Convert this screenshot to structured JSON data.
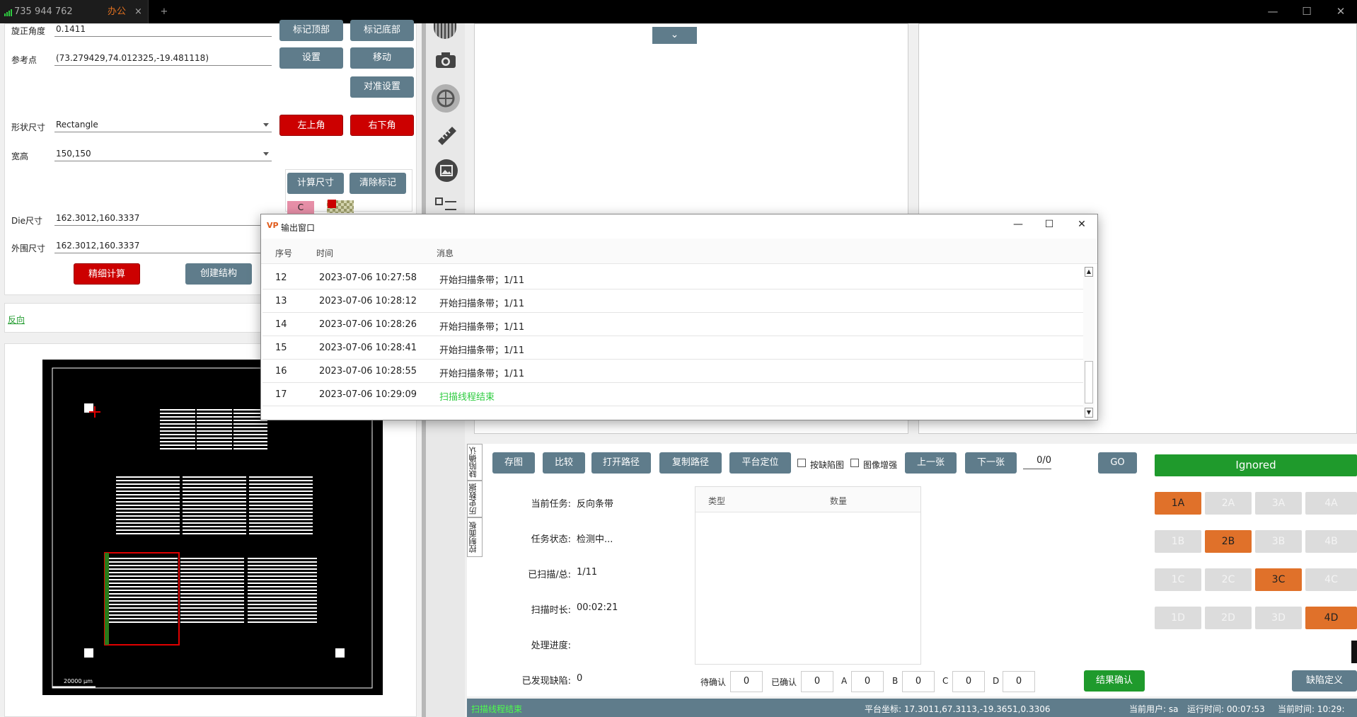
{
  "titlebar": {
    "tab_title": "735 944 762",
    "tab_group": "办公",
    "close_tab": "×",
    "new_tab": "+",
    "minimize": "—",
    "maximize": "☐",
    "close": "✕"
  },
  "settings": {
    "rotation_label": "旋正角度",
    "rotation_value": "0.1411",
    "ref_label": "参考点",
    "ref_value": "(73.279429,74.012325,-19.481118)",
    "shape_label": "形状尺寸",
    "shape_value": "Rectangle",
    "wh_label": "宽高",
    "wh_value": "150,150",
    "die_label": "Die尺寸",
    "die_value": "162.3012,160.3337",
    "outer_label": "外围尺寸",
    "outer_value": "162.3012,160.3337",
    "btn_mark_top": "标记顶部",
    "btn_mark_bottom": "标记底部",
    "btn_set": "设置",
    "btn_move": "移动",
    "btn_align": "对准设置",
    "btn_top_left": "左上角",
    "btn_bottom_right": "右下角",
    "btn_calc": "计算尺寸",
    "btn_clear": "清除标记",
    "swatch_c": "C",
    "btn_fine": "精细计算",
    "btn_create": "创建结构"
  },
  "reverse_label": "反向",
  "preview": {
    "scale_label": "20000 μm"
  },
  "dialog": {
    "title": "输出窗口",
    "col_seq": "序号",
    "col_time": "时间",
    "col_msg": "消息",
    "rows": [
      {
        "seq": "12",
        "time": "2023-07-06 10:27:58",
        "msg": "开始扫描条带；1/11"
      },
      {
        "seq": "13",
        "time": "2023-07-06 10:28:12",
        "msg": "开始扫描条带；1/11"
      },
      {
        "seq": "14",
        "time": "2023-07-06 10:28:26",
        "msg": "开始扫描条带；1/11"
      },
      {
        "seq": "15",
        "time": "2023-07-06 10:28:41",
        "msg": "开始扫描条带；1/11"
      },
      {
        "seq": "16",
        "time": "2023-07-06 10:28:55",
        "msg": "开始扫描条带；1/11"
      },
      {
        "seq": "17",
        "time": "2023-07-06 10:29:09",
        "msg": "扫描线程结束"
      }
    ]
  },
  "bottom": {
    "vtabs": [
      "缺陷确认",
      "历史数据",
      "控制面板"
    ],
    "btn_save": "存图",
    "btn_compare": "比较",
    "btn_open_path": "打开路径",
    "btn_copy_path": "复制路径",
    "btn_locate": "平台定位",
    "chk_defect": "按缺陷图",
    "chk_enhance": "图像增强",
    "btn_prev": "上一张",
    "btn_next": "下一张",
    "page": "0/0",
    "btn_go": "GO",
    "ignored": "Ignored",
    "task_label": "当前任务:",
    "task_value": "反向条带",
    "status_label": "任务状态:",
    "status_value": "检测中...",
    "scanned_label": "已扫描/总:",
    "scanned_value": "1/11",
    "duration_label": "扫描时长:",
    "duration_value": "00:02:21",
    "progress_label": "处理进度:",
    "found_label": "已发现缺陷:",
    "found_value": "0",
    "table_type": "类型",
    "table_count": "数量",
    "pending_label": "待确认",
    "pending_value": "0",
    "confirmed_label": "已确认",
    "confirmed_value": "0",
    "a_label": "A",
    "a_value": "0",
    "b_label": "B",
    "b_value": "0",
    "c_label": "C",
    "c_value": "0",
    "d_label": "D",
    "d_value": "0",
    "btn_confirm": "结果确认",
    "btn_defect_def": "缺陷定义",
    "grid": [
      [
        "1A",
        "2A",
        "3A",
        "4A"
      ],
      [
        "1B",
        "2B",
        "3B",
        "4B"
      ],
      [
        "1C",
        "2C",
        "3C",
        "4C"
      ],
      [
        "1D",
        "2D",
        "3D",
        "4D"
      ]
    ]
  },
  "statusbar": {
    "left": "扫描线程结束",
    "coord": "平台坐标: 17.3011,67.3113,-19.3651,0.3306",
    "user": "当前用户: sa",
    "runtime": "运行时间: 00:07:53",
    "time": "当前时间: 10:29:"
  },
  "colors": {
    "slate": "#5f7c8b",
    "red": "#cc0000",
    "green": "#1f9a2c",
    "orange": "#e0712a"
  }
}
